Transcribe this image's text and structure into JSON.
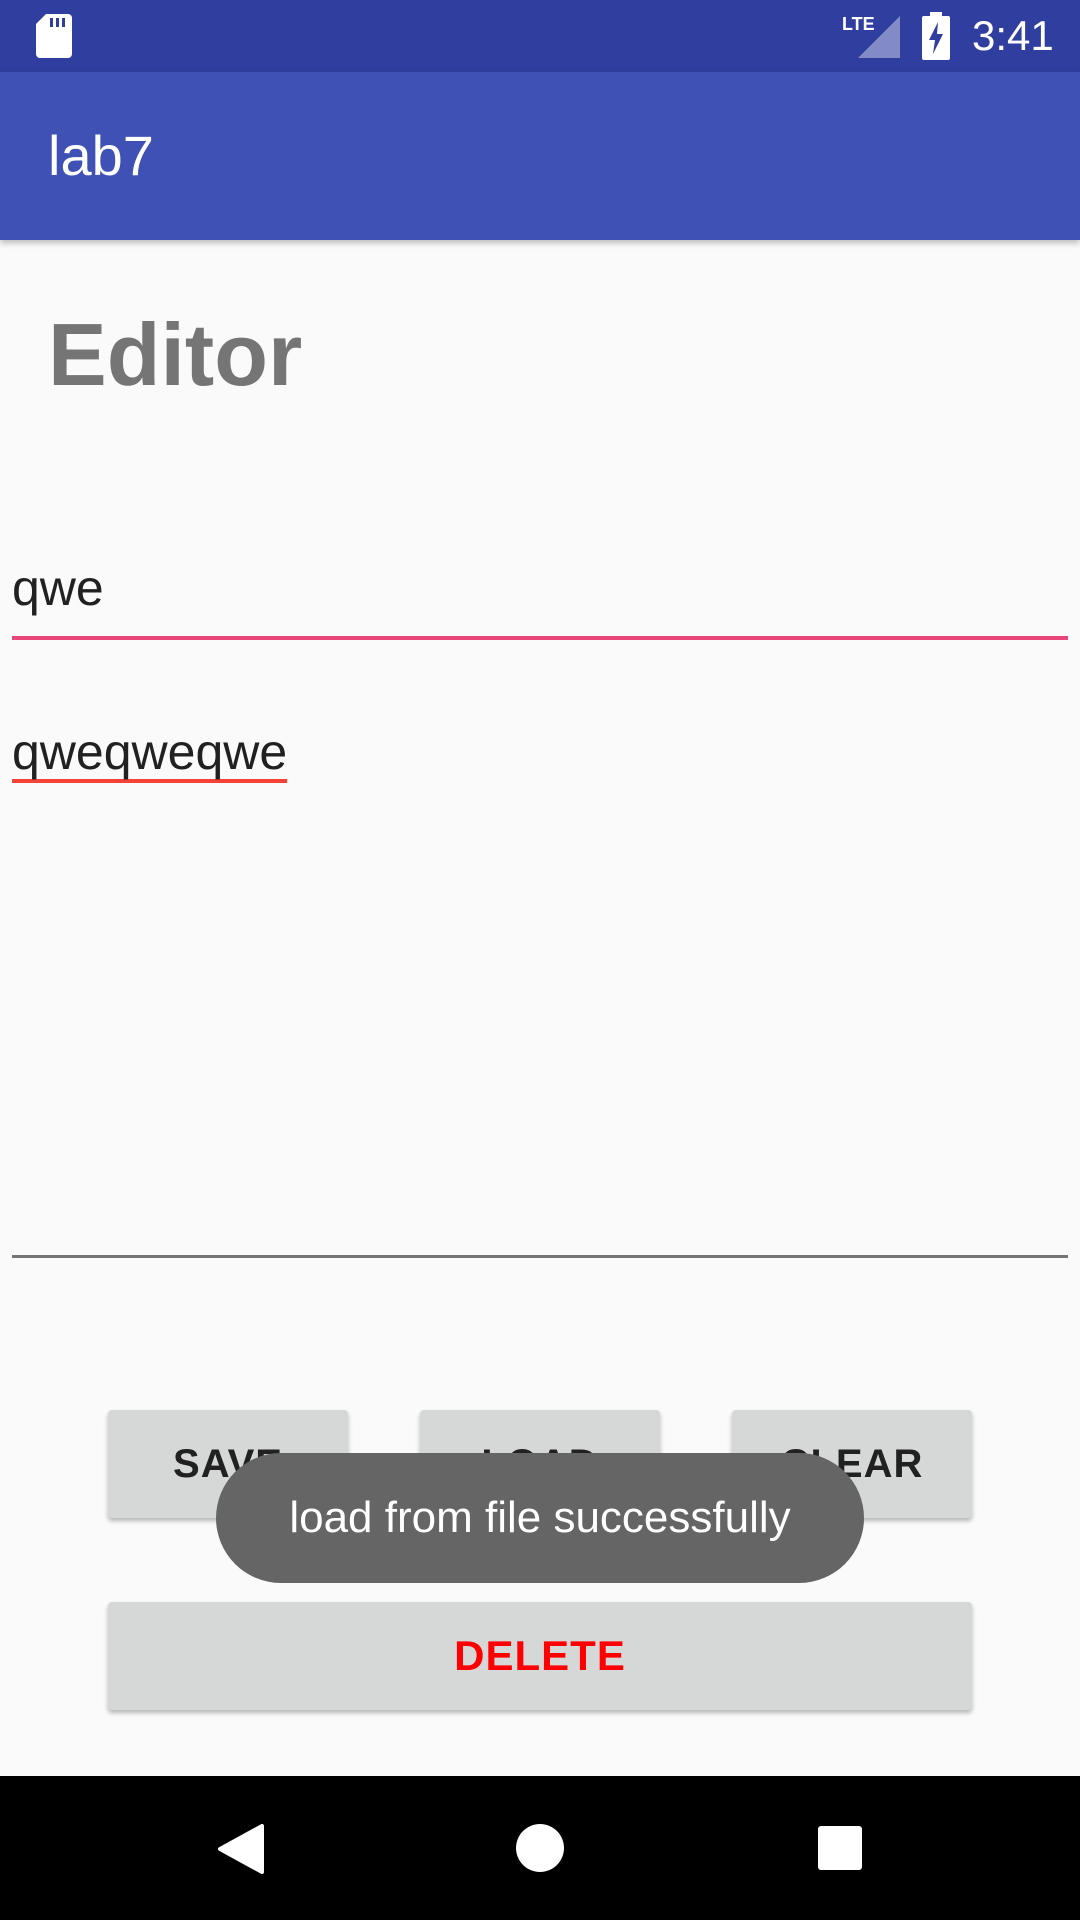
{
  "status_bar": {
    "time": "3:41",
    "network": "LTE",
    "icons": [
      "sd-card-icon",
      "lte-signal-icon",
      "battery-charging-icon"
    ]
  },
  "app_bar": {
    "title": "lab7"
  },
  "editor": {
    "heading": "Editor",
    "title_value": "qwe",
    "body_value": "qweqweqwe"
  },
  "buttons": {
    "save": "SAVE",
    "load": "LOAD",
    "clear": "CLEAR",
    "delete": "DELETE"
  },
  "toast": {
    "message": "load from file successfully"
  },
  "nav_bar": {
    "icons": [
      "back-icon",
      "home-icon",
      "recents-icon"
    ]
  },
  "colors": {
    "status_bar": "#303f9f",
    "app_bar": "#3f51b5",
    "accent": "#e94577",
    "delete_text": "#ff0000"
  }
}
